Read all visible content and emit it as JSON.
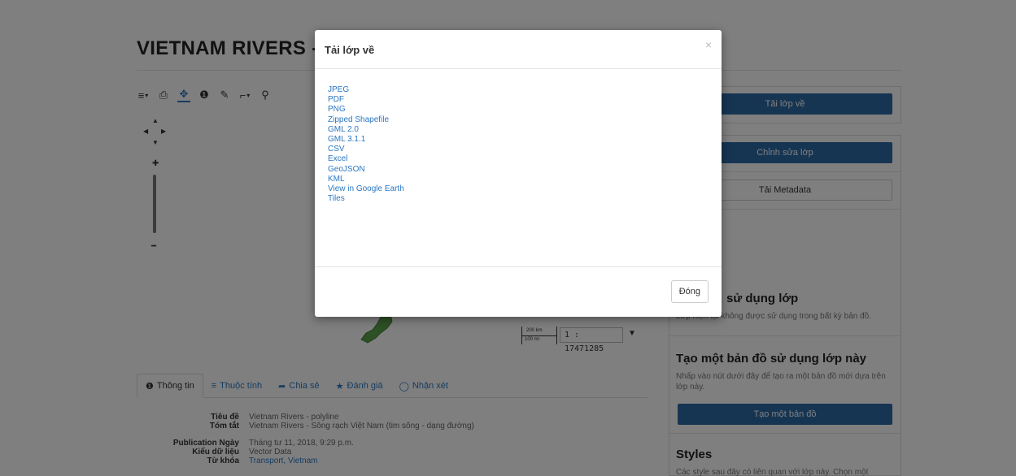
{
  "page": {
    "title": "VIETNAM RIVERS - "
  },
  "toolbar": {
    "items": [
      {
        "icon": "menu-icon",
        "glyph": "≡"
      },
      {
        "icon": "print-icon",
        "glyph": "⎙"
      },
      {
        "icon": "pan-icon",
        "glyph": "✥"
      },
      {
        "icon": "info-icon",
        "glyph": "❶"
      },
      {
        "icon": "draw-icon",
        "glyph": "✎"
      },
      {
        "icon": "measure-icon",
        "glyph": "⌐"
      },
      {
        "icon": "zoom-icon",
        "glyph": "⚲"
      }
    ]
  },
  "map": {
    "scale_top": "200 km",
    "scale_bottom": "100 mi",
    "scale_value": "1 : 17471285"
  },
  "tabs": [
    {
      "icon": "❶",
      "label": "Thông tin"
    },
    {
      "icon": "≡",
      "label": "Thuộc tính"
    },
    {
      "icon": "➦",
      "label": "Chia sẻ"
    },
    {
      "icon": "★",
      "label": "Đánh giá"
    },
    {
      "icon": "◯",
      "label": "Nhận xét"
    }
  ],
  "info": {
    "rows": [
      {
        "key": "Tiêu đề",
        "value": "Vietnam Rivers - polyline"
      },
      {
        "key": "Tóm tắt",
        "value": "Vietnam Rivers - Sông rạch Việt Nam (tim sông - dạng đường)"
      },
      {
        "key": "Publication Ngày",
        "value": "Tháng tư 11, 2018, 9:29 p.m."
      },
      {
        "key": "Kiểu dữ liệu",
        "value": "Vector Data"
      },
      {
        "key": "Từ khóa",
        "value": "Transport, Vietnam"
      }
    ]
  },
  "sidebar": {
    "download_layer": "Tải lớp về",
    "edit_layer": "Chỉnh sửa lớp",
    "download_metadata": "Tải Metadata",
    "maps_using_heading": "sử dụng lớp",
    "maps_using_text_partial": "Lớp hiện tại không được sử dụng trong bất kỳ bản đồ.",
    "create_map_heading": "Tạo một bản đồ sử dụng lớp này",
    "create_map_text": "Nhấp vào nút dưới đây để tạo ra một bản đồ mới dựa trên lớp này.",
    "create_map_button": "Tạo một bản đồ",
    "styles_heading": "Styles",
    "styles_text": "Các style sau đây có liên quan với lớp này. Chọn một"
  },
  "modal": {
    "title": "Tải lớp về",
    "close_glyph": "×",
    "formats": [
      "JPEG",
      "PDF",
      "PNG",
      "Zipped Shapefile",
      "GML 2.0",
      "GML 3.1.1",
      "CSV",
      "Excel",
      "GeoJSON",
      "KML",
      "View in Google Earth",
      "Tiles"
    ],
    "close_button": "Đóng"
  },
  "colors": {
    "primary": "#2d6aa6",
    "link": "#2a78c2",
    "overlay": "rgba(0,0,0,0.5)"
  }
}
